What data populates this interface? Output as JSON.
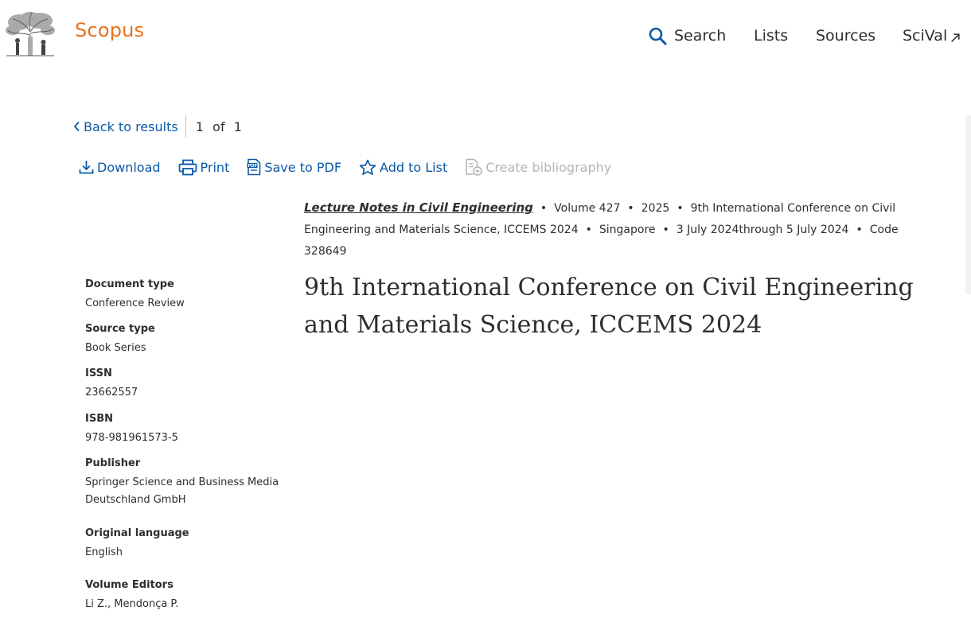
{
  "header": {
    "brand": "Scopus",
    "nav": {
      "search": "Search",
      "lists": "Lists",
      "sources": "Sources",
      "scival": "SciVal"
    }
  },
  "results_nav": {
    "back_label": "Back to results",
    "current": "1",
    "of_label": "of",
    "total": "1"
  },
  "toolbar": {
    "download": "Download",
    "print": "Print",
    "save_pdf": "Save to PDF",
    "add_list": "Add to List",
    "create_bibliography": "Create bibliography"
  },
  "document": {
    "source_title": "Lecture Notes in Civil Engineering",
    "volume": "Volume 427",
    "year": "2025",
    "conference_name": "9th International Conference on Civil Engineering and Materials Science, ICCEMS 2024",
    "location": "Singapore",
    "dates": "3 July 2024through 5 July 2024",
    "code": "Code 328649",
    "title": "9th International Conference on Civil Engineering and Materials Science, ICCEMS 2024"
  },
  "details": {
    "document_type_label": "Document type",
    "document_type": "Conference Review",
    "source_type_label": "Source type",
    "source_type": "Book Series",
    "issn_label": "ISSN",
    "issn": "23662557",
    "isbn_label": "ISBN",
    "isbn": "978-981961573-5",
    "publisher_label": "Publisher",
    "publisher": "Springer Science and Business Media Deutschland GmbH",
    "language_label": "Original language",
    "language": "English",
    "editors_label": "Volume Editors",
    "editors": "Li Z., Mendonça P."
  },
  "colors": {
    "brand": "#e9711c",
    "link": "#0b59a7",
    "disabled": "#b5b5b5",
    "text": "#2e2e2e"
  }
}
